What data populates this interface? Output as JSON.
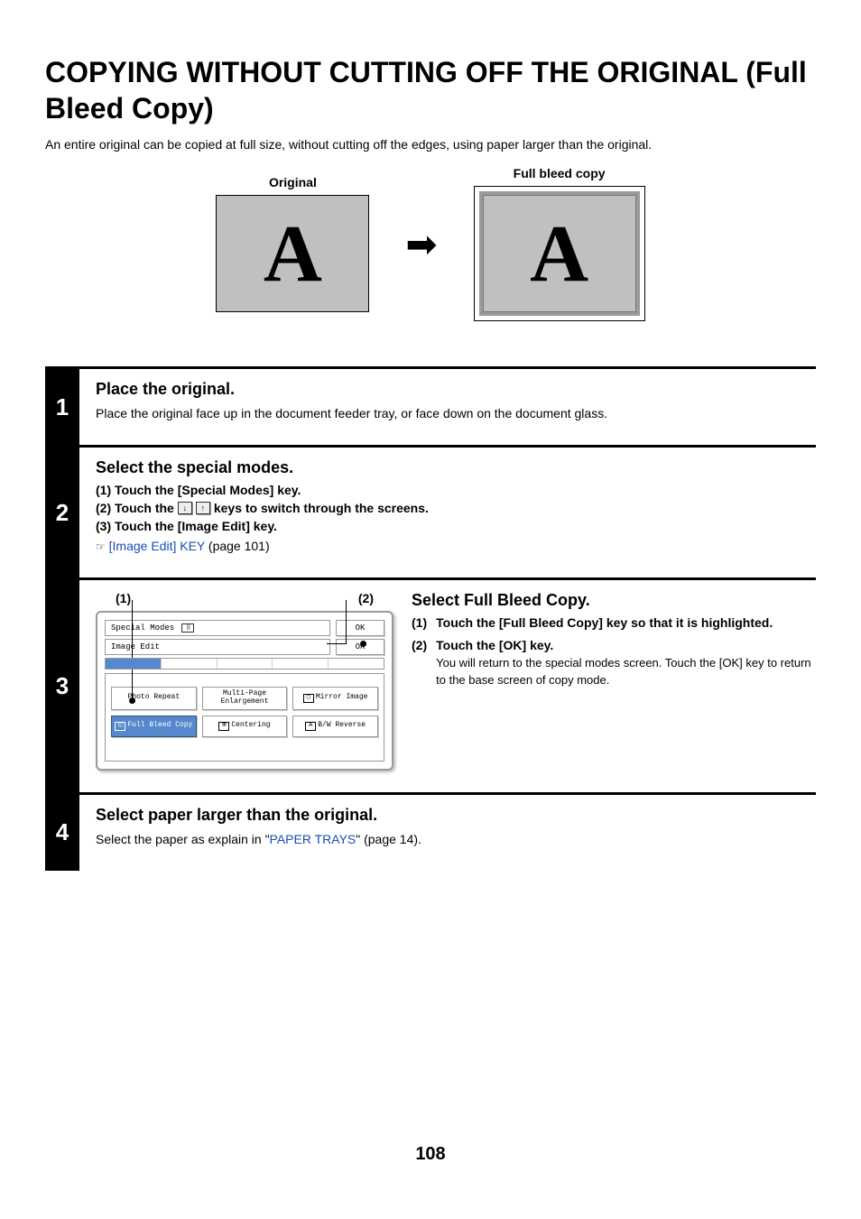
{
  "title": "COPYING WITHOUT CUTTING OFF THE ORIGINAL (Full Bleed Copy)",
  "subtitle": "An entire original can be copied at full size, without cutting off the edges, using paper larger than the original.",
  "illus": {
    "original_label": "Original",
    "full_bleed_label": "Full bleed copy",
    "letter": "A"
  },
  "steps": {
    "s1": {
      "num": "1",
      "title": "Place the original.",
      "text": "Place the original face up in the document feeder tray, or face down on the document glass."
    },
    "s2": {
      "num": "2",
      "title": "Select the special modes.",
      "i1": "(1)   Touch the [Special Modes] key.",
      "i2a": "(2)   Touch the ",
      "i2b": " keys to switch through the screens.",
      "i3": "(3)   Touch the [Image Edit] key.",
      "ref_icon": "☞",
      "ref_link": "[Image Edit] KEY",
      "ref_tail": " (page 101)"
    },
    "s3": {
      "num": "3",
      "callout1": "(1)",
      "callout2": "(2)",
      "panel": {
        "special_modes": "Special Modes",
        "image_edit": "Image Edit",
        "ok": "OK",
        "photo_repeat": "Photo Repeat",
        "multi_page": "Multi-Page\nEnlargement",
        "mirror": "Mirror\nImage",
        "full_bleed": "Full Bleed\nCopy",
        "centering": "Centering",
        "bw_reverse": "B/W\nReverse"
      },
      "right": {
        "title": "Select Full Bleed Copy.",
        "i1_num": "(1)",
        "i1": "Touch the [Full Bleed Copy] key so that it is highlighted.",
        "i2_num": "(2)",
        "i2_title": "Touch the [OK] key.",
        "i2_text": "You will return to the special modes screen. Touch the [OK] key to return to the base screen of copy mode."
      }
    },
    "s4": {
      "num": "4",
      "title": "Select paper larger than the original.",
      "text_a": "Select the paper as explain in \"",
      "link": "PAPER TRAYS",
      "text_b": "\" (page 14)."
    }
  },
  "page_number": "108"
}
